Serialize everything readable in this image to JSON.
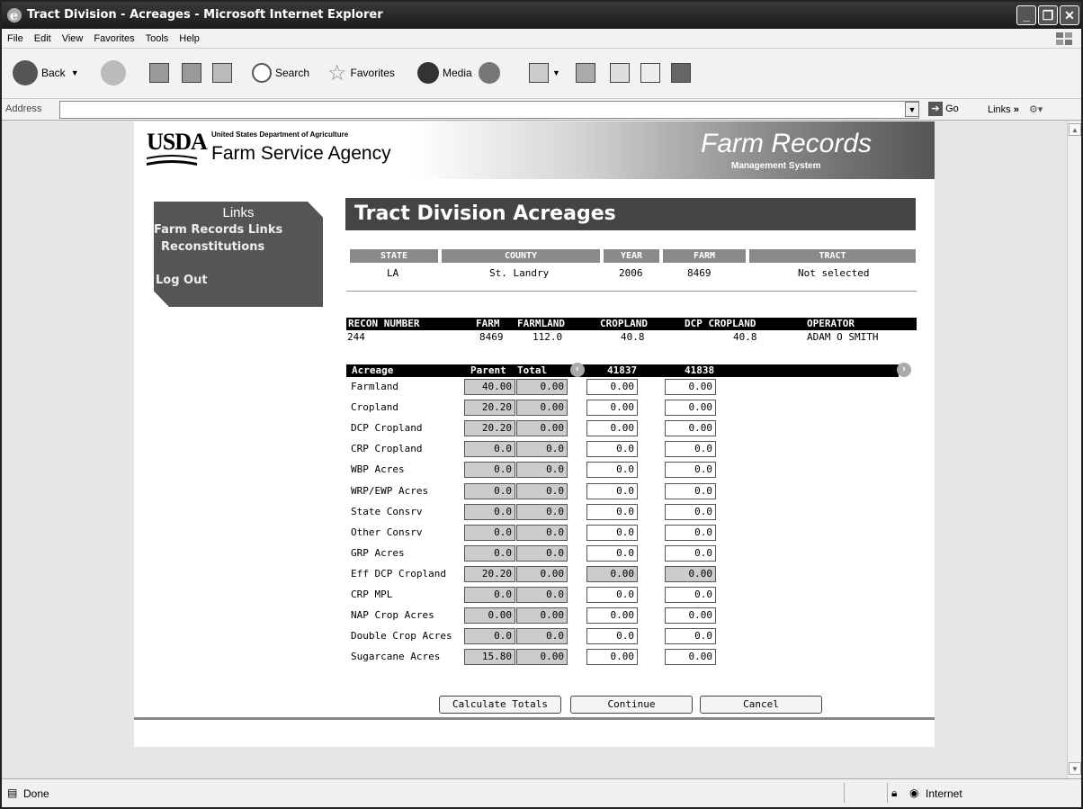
{
  "window": {
    "title": "Tract Division - Acreages - Microsoft Internet Explorer"
  },
  "menu": [
    "File",
    "Edit",
    "View",
    "Favorites",
    "Tools",
    "Help"
  ],
  "toolbar": {
    "back": "Back",
    "search": "Search",
    "favorites": "Favorites",
    "media": "Media"
  },
  "address": {
    "label": "Address",
    "value": "",
    "go": "Go",
    "links": "Links"
  },
  "status": {
    "text": "Done",
    "zone": "Internet"
  },
  "banner": {
    "usda": "USDA",
    "dept": "United States Department of Agriculture",
    "agency": "Farm Service Agency",
    "app_title": "Farm Records",
    "app_sub": "Management System"
  },
  "links": {
    "header": "Links",
    "items": [
      "Farm Records Links",
      "Reconstitutions",
      "Log Out"
    ]
  },
  "main": {
    "title": "Tract Division Acreages"
  },
  "summary": {
    "headers": [
      "STATE",
      "COUNTY",
      "YEAR",
      "FARM",
      "TRACT"
    ],
    "values": [
      "LA",
      "St. Landry",
      "2006",
      "8469",
      "Not selected"
    ]
  },
  "recon": {
    "headers": [
      "RECON NUMBER",
      "FARM",
      "FARMLAND",
      "CROPLAND",
      "DCP CROPLAND",
      "OPERATOR"
    ],
    "values": [
      "244",
      "8469",
      "112.0",
      "40.8",
      "40.8",
      "ADAM O SMITH"
    ]
  },
  "acreage": {
    "headers": [
      "Acreage",
      "Parent",
      "Total",
      "41837",
      "41838"
    ],
    "rows": [
      {
        "label": "Farmland",
        "parent": "40.00",
        "total": "0.00",
        "t1": "0.00",
        "t2": "0.00"
      },
      {
        "label": "Cropland",
        "parent": "20.20",
        "total": "0.00",
        "t1": "0.00",
        "t2": "0.00"
      },
      {
        "label": "DCP Cropland",
        "parent": "20.20",
        "total": "0.00",
        "t1": "0.00",
        "t2": "0.00"
      },
      {
        "label": "CRP Cropland",
        "parent": "0.0",
        "total": "0.0",
        "t1": "0.0",
        "t2": "0.0"
      },
      {
        "label": "WBP Acres",
        "parent": "0.0",
        "total": "0.0",
        "t1": "0.0",
        "t2": "0.0"
      },
      {
        "label": "WRP/EWP Acres",
        "parent": "0.0",
        "total": "0.0",
        "t1": "0.0",
        "t2": "0.0"
      },
      {
        "label": "State Consrv",
        "parent": "0.0",
        "total": "0.0",
        "t1": "0.0",
        "t2": "0.0"
      },
      {
        "label": "Other Consrv",
        "parent": "0.0",
        "total": "0.0",
        "t1": "0.0",
        "t2": "0.0"
      },
      {
        "label": "GRP Acres",
        "parent": "0.0",
        "total": "0.0",
        "t1": "0.0",
        "t2": "0.0"
      },
      {
        "label": "Eff DCP Cropland",
        "parent": "20.20",
        "total": "0.00",
        "t1": "0.00",
        "t2": "0.00"
      },
      {
        "label": "CRP MPL",
        "parent": "0.0",
        "total": "0.0",
        "t1": "0.0",
        "t2": "0.0"
      },
      {
        "label": "NAP Crop Acres",
        "parent": "0.00",
        "total": "0.00",
        "t1": "0.00",
        "t2": "0.00"
      },
      {
        "label": "Double Crop Acres",
        "parent": "0.0",
        "total": "0.0",
        "t1": "0.0",
        "t2": "0.0"
      },
      {
        "label": "Sugarcane Acres",
        "parent": "15.80",
        "total": "0.00",
        "t1": "0.00",
        "t2": "0.00"
      }
    ]
  },
  "buttons": {
    "calculate": "Calculate Totals",
    "continue": "Continue",
    "cancel": "Cancel"
  },
  "colors": {
    "title_bar": "#1a1a1a",
    "header_grey": "#8a8a8a",
    "box_grey": "#cccccc"
  }
}
